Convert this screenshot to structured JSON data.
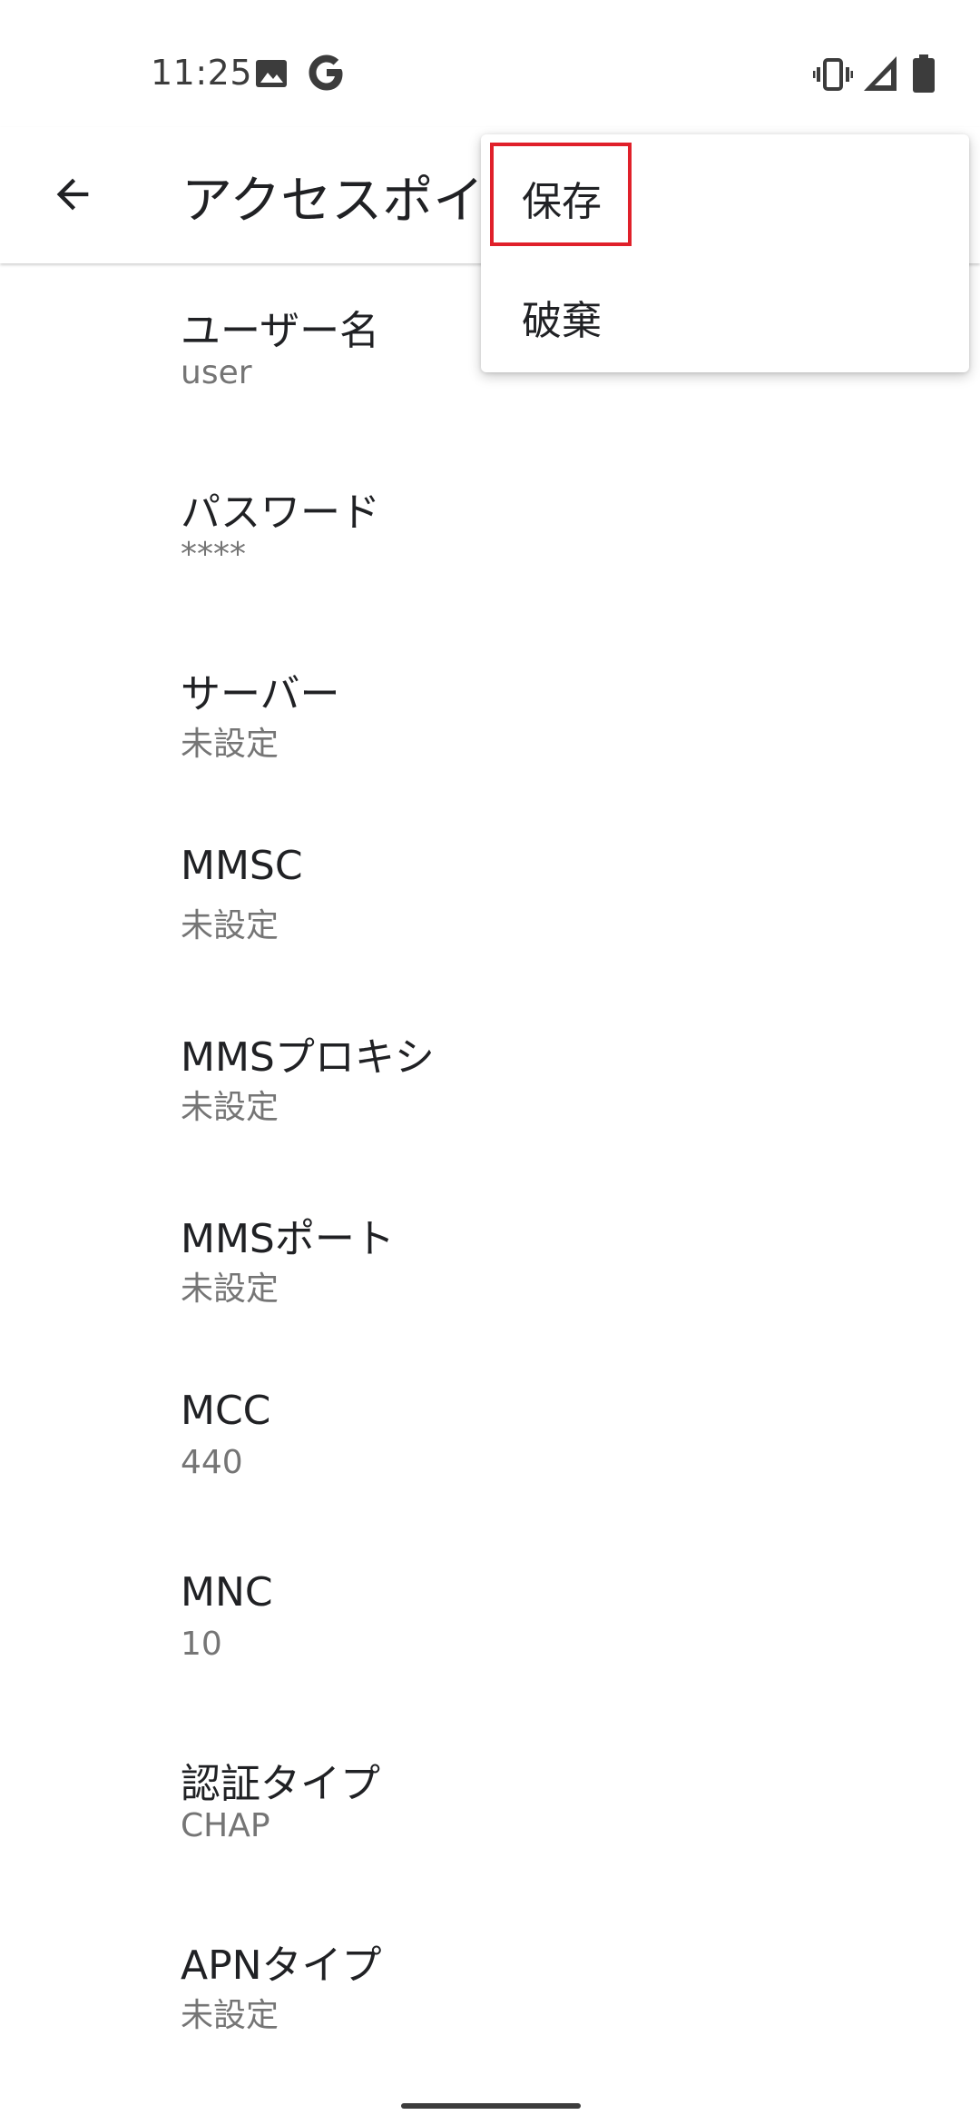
{
  "status_bar": {
    "time": "11:25",
    "icons": [
      "image-icon",
      "google-icon",
      "vibrate-icon",
      "signal-icon",
      "battery-icon"
    ]
  },
  "app_bar": {
    "title": "アクセスポイ",
    "back_icon": "arrow-back-icon"
  },
  "menu": {
    "items": [
      {
        "label": "保存"
      },
      {
        "label": "破棄"
      }
    ],
    "highlight_color": "#e0202a"
  },
  "preferences": [
    {
      "title": "ユーザー名",
      "summary": "user"
    },
    {
      "title": "パスワード",
      "summary": "****"
    },
    {
      "title": "サーバー",
      "summary": "未設定"
    },
    {
      "title": "MMSC",
      "summary": "未設定"
    },
    {
      "title": "MMSプロキシ",
      "summary": "未設定"
    },
    {
      "title": "MMSポート",
      "summary": "未設定"
    },
    {
      "title": "MCC",
      "summary": "440"
    },
    {
      "title": "MNC",
      "summary": "10"
    },
    {
      "title": "認証タイプ",
      "summary": "CHAP"
    },
    {
      "title": "APNタイプ",
      "summary": "未設定"
    }
  ]
}
